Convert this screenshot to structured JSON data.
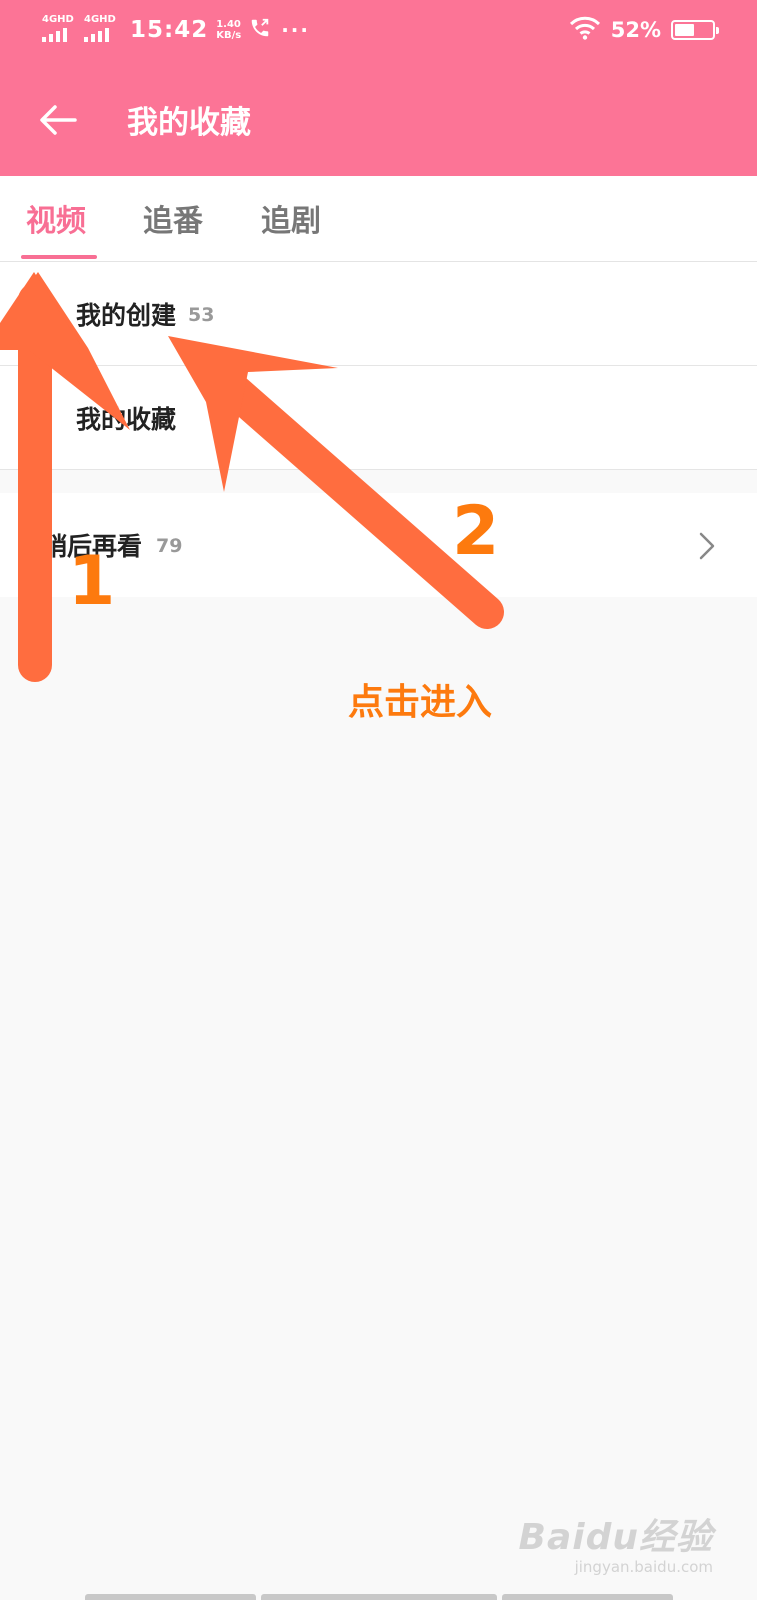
{
  "status_bar": {
    "network_1": "4GHD",
    "network_2": "4GHD",
    "time": "15:42",
    "speed_value": "1.40",
    "speed_unit": "KB/s",
    "more": "···",
    "battery_percent": "52%",
    "battery_level": 0.52,
    "phone_icon": "phone-call-icon",
    "wifi_icon": "wifi-icon"
  },
  "app_bar": {
    "title": "我的收藏",
    "back_icon": "arrow-left-icon"
  },
  "tabs": [
    {
      "label": "视频",
      "active": true
    },
    {
      "label": "追番",
      "active": false
    },
    {
      "label": "追剧",
      "active": false
    }
  ],
  "folders": [
    {
      "label": "我的创建",
      "count": "53"
    },
    {
      "label": "我的收藏",
      "count": ""
    }
  ],
  "watch_later": {
    "label": "稍后再看",
    "count": "79",
    "chevron_icon": "chevron-right-icon"
  },
  "annotations": {
    "step_1": "1",
    "step_2": "2",
    "hint": "点击进入",
    "arrow_color": "#ff6d3f",
    "text_color": "#fd7a0e"
  },
  "watermark": {
    "logo": "Baidu经验",
    "url": "jingyan.baidu.com"
  },
  "colors": {
    "header_pink": "#fc7496",
    "tab_active": "#f86f94"
  }
}
